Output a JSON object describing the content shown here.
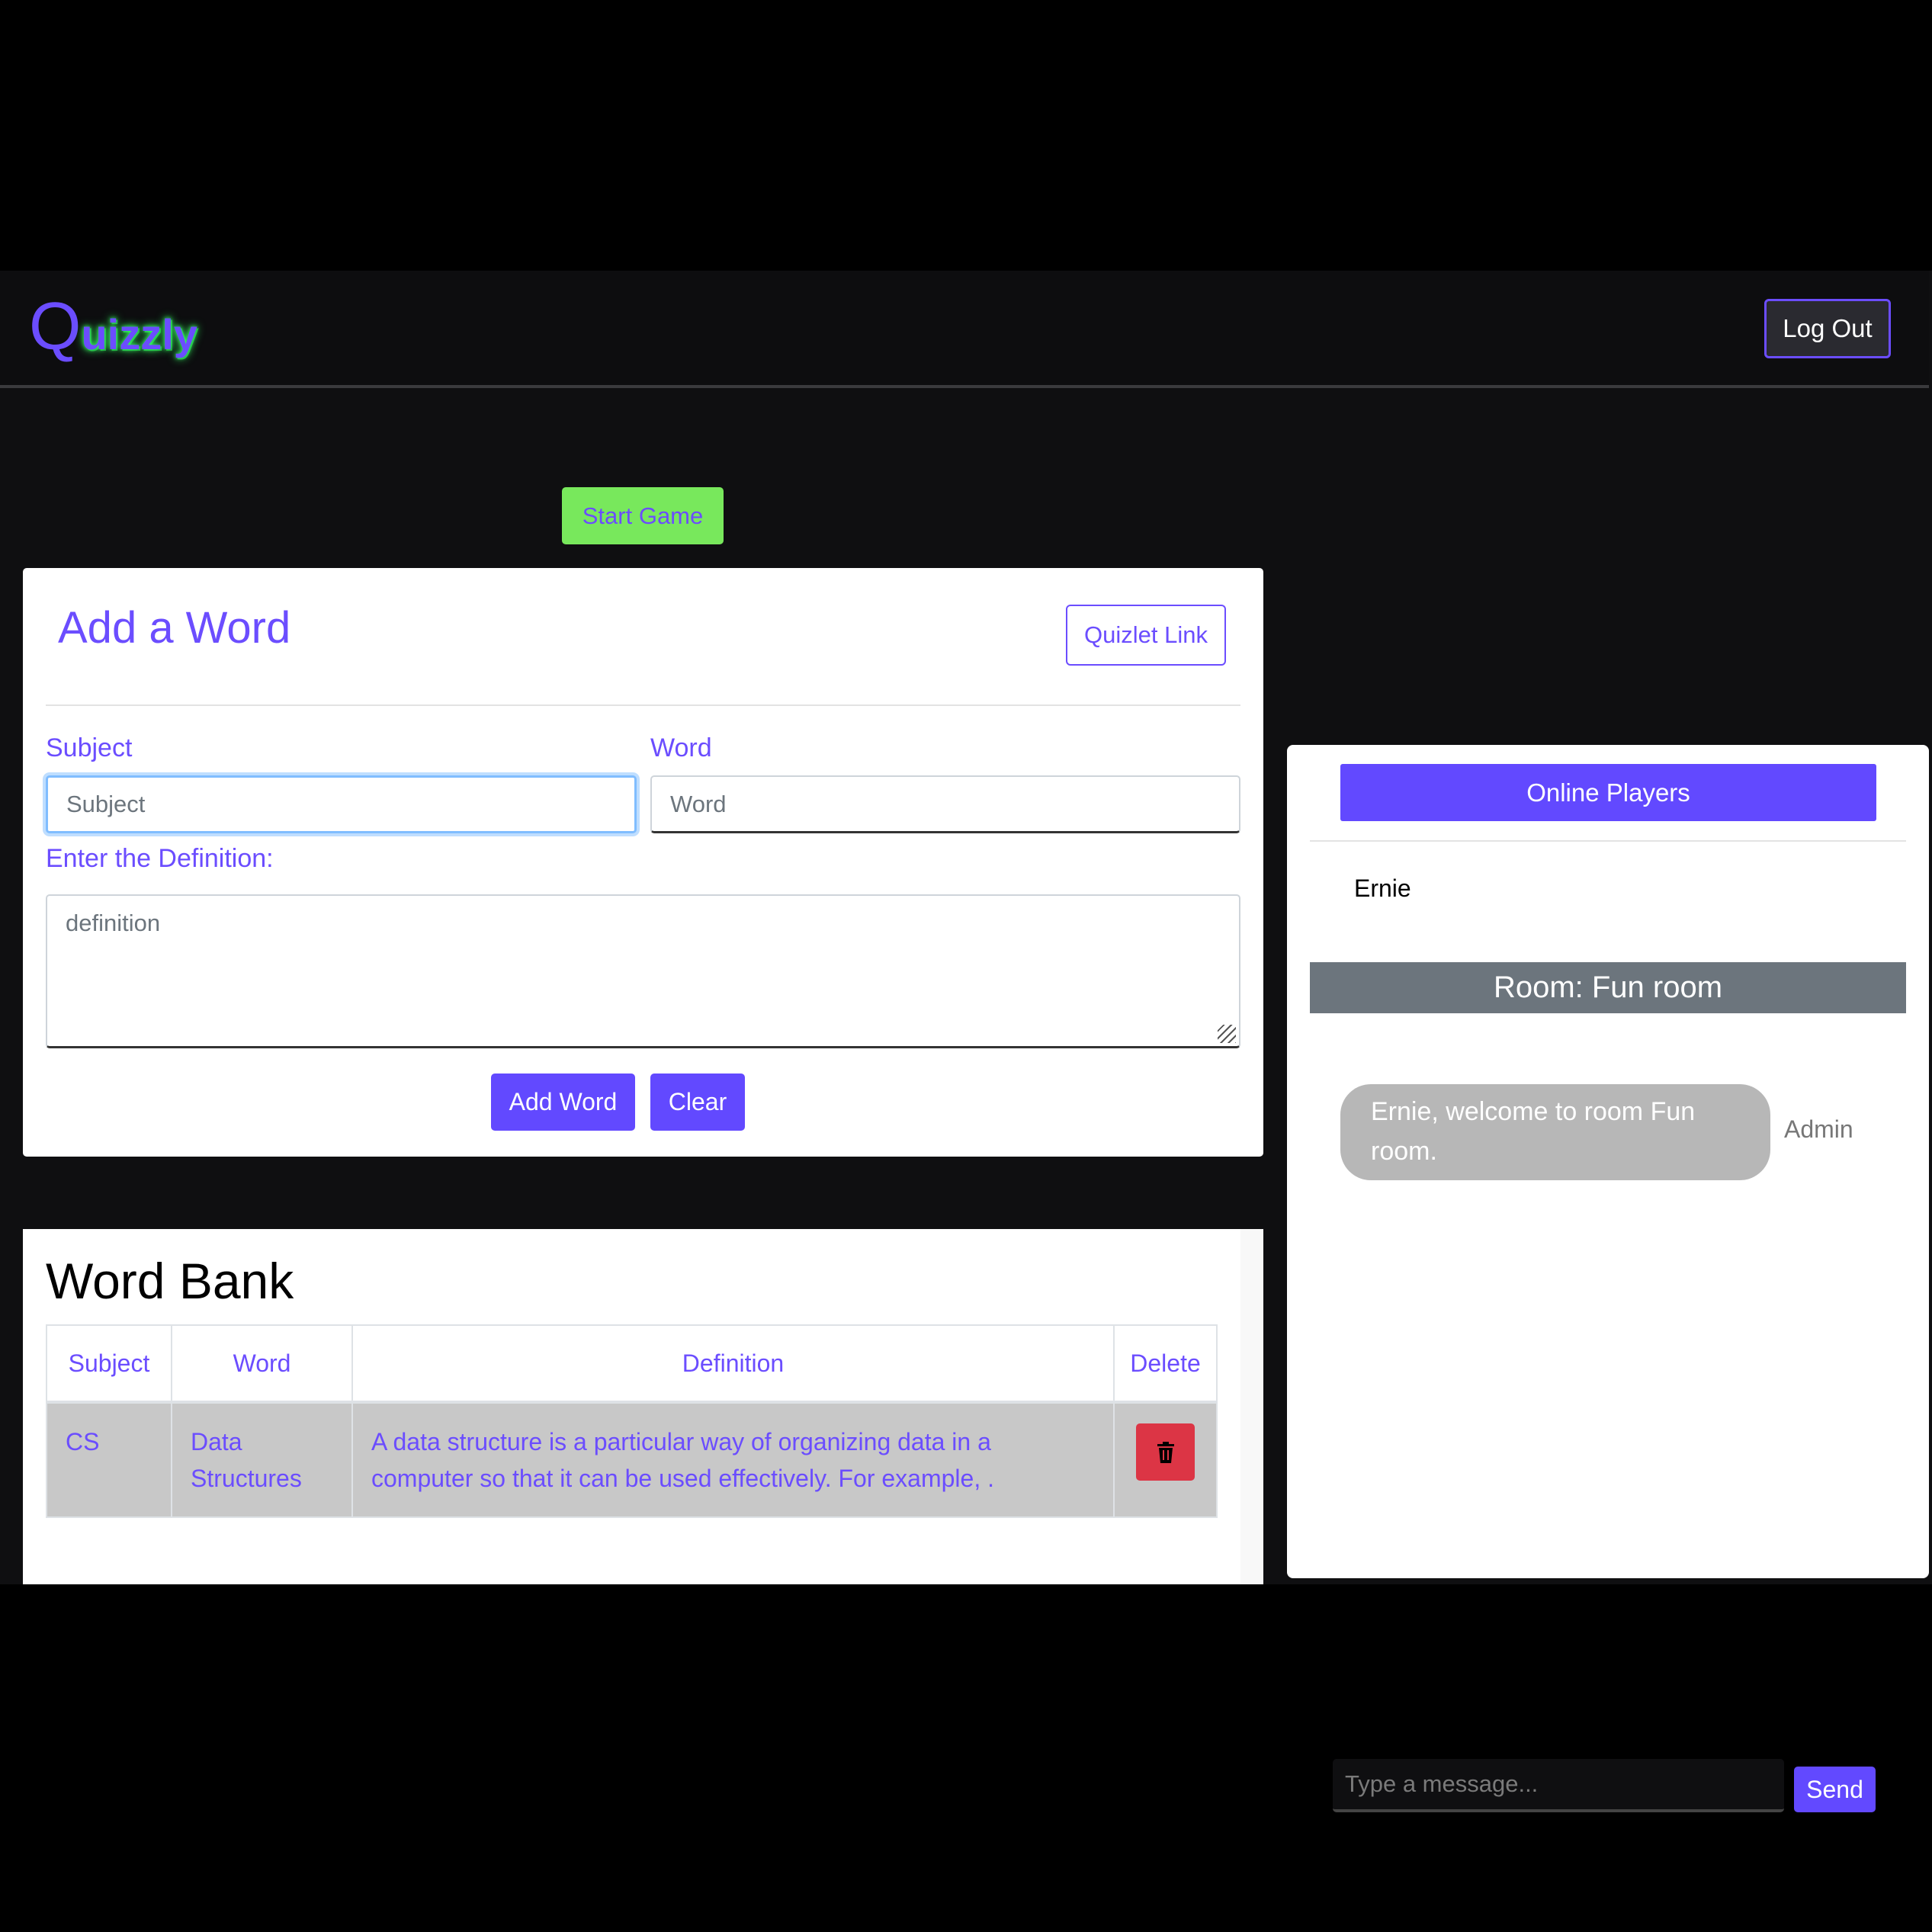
{
  "navbar": {
    "logo_q": "Q",
    "logo_rest": "uizzly",
    "logout_label": "Log Out"
  },
  "start_game_label": "Start Game",
  "add_word": {
    "title": "Add a Word",
    "quizlet_label": "Quizlet Link",
    "subject_label": "Subject",
    "subject_placeholder": "Subject",
    "word_label": "Word",
    "word_placeholder": "Word",
    "definition_label": "Enter the Definition:",
    "definition_placeholder": "definition",
    "add_button": "Add Word",
    "clear_button": "Clear"
  },
  "word_bank": {
    "title": "Word Bank",
    "headers": [
      "Subject",
      "Word",
      "Definition",
      "Delete"
    ],
    "rows": [
      {
        "subject": "CS",
        "word": "Data Structures",
        "definition": "A data structure is a particular way of organizing data in a computer so that it can be used effectively. For example, ."
      }
    ]
  },
  "chat": {
    "online_players_label": "Online Players",
    "players": [
      "Ernie"
    ],
    "room_label": "Room: Fun room",
    "messages": [
      {
        "text": "Ernie, welcome to room Fun room.",
        "sender": "Admin"
      }
    ],
    "input_placeholder": "Type a message...",
    "send_label": "Send"
  },
  "icons": {
    "delete": "trash-icon"
  },
  "colors": {
    "accent": "#6249ff",
    "start": "#78e85c",
    "danger": "#dc3545",
    "room": "#6c757d"
  }
}
